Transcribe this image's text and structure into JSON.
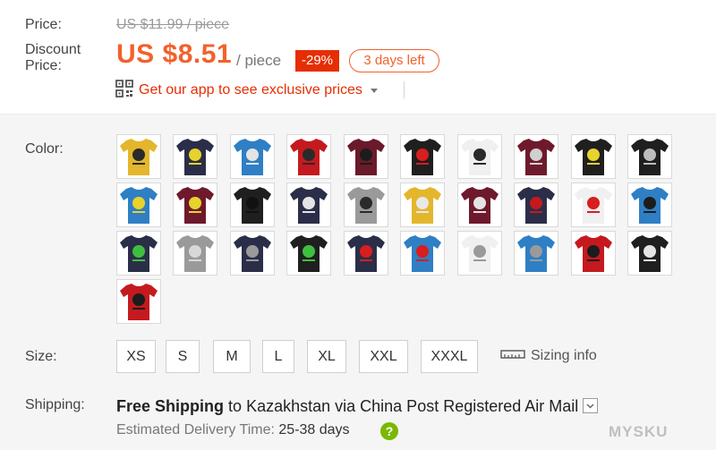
{
  "price": {
    "label": "Price:",
    "original": "US $11.99 / piece",
    "discount_label_line1": "Discount",
    "discount_label_line2": "Price:",
    "sale": "US $8.51",
    "per": "/ piece",
    "badge": "-29%",
    "countdown": "3 days left"
  },
  "app_promo": {
    "text": "Get our app to see exclusive prices",
    "icon": "qr-code-icon"
  },
  "color": {
    "label": "Color:",
    "options": [
      {
        "shirt": "#e3b62c",
        "print": "#2a2a2a"
      },
      {
        "shirt": "#2b2e48",
        "print": "#e8d22d"
      },
      {
        "shirt": "#2f7fc4",
        "print": "#e4e4e4"
      },
      {
        "shirt": "#c41a1f",
        "print": "#2a2a2a"
      },
      {
        "shirt": "#6a1a2a",
        "print": "#1c1c1c"
      },
      {
        "shirt": "#1f1f1f",
        "print": "#d81e1e"
      },
      {
        "shirt": "#f0f0f0",
        "print": "#2a2a2a"
      },
      {
        "shirt": "#6e1a2c",
        "print": "#d0d0d0"
      },
      {
        "shirt": "#1f1f1f",
        "print": "#e8d22d"
      },
      {
        "shirt": "#1f1f1f",
        "print": "#bdbdbd"
      },
      {
        "shirt": "#2f7fc4",
        "print": "#e8d22d"
      },
      {
        "shirt": "#6e1a2c",
        "print": "#e8d22d"
      },
      {
        "shirt": "#1f1f1f",
        "print": "#111111"
      },
      {
        "shirt": "#2b2e48",
        "print": "#e4e4e4"
      },
      {
        "shirt": "#9a9a9a",
        "print": "#2a2a2a"
      },
      {
        "shirt": "#e3b62c",
        "print": "#e8e8e8"
      },
      {
        "shirt": "#6e1a2c",
        "print": "#e4e4e4"
      },
      {
        "shirt": "#2b2e48",
        "print": "#c41a1f"
      },
      {
        "shirt": "#f0f0f0",
        "print": "#d81e1e"
      },
      {
        "shirt": "#2f7fc4",
        "print": "#1c1c1c"
      },
      {
        "shirt": "#2b2e48",
        "print": "#3fbf3f"
      },
      {
        "shirt": "#9a9a9a",
        "print": "#d8d8d8"
      },
      {
        "shirt": "#2b2e48",
        "print": "#9a9a9a"
      },
      {
        "shirt": "#1f1f1f",
        "print": "#3fbf3f"
      },
      {
        "shirt": "#2b2e48",
        "print": "#d81e1e"
      },
      {
        "shirt": "#2f7fc4",
        "print": "#d81e1e"
      },
      {
        "shirt": "#f0f0f0",
        "print": "#9a9a9a"
      },
      {
        "shirt": "#2f7fc4",
        "print": "#9a9a9a"
      },
      {
        "shirt": "#c41a1f",
        "print": "#1c1c1c"
      },
      {
        "shirt": "#1f1f1f",
        "print": "#e4e4e4"
      },
      {
        "shirt": "#c41a1f",
        "print": "#1c1c1c"
      }
    ]
  },
  "size": {
    "label": "Size:",
    "options": [
      "XS",
      "S",
      "M",
      "L",
      "XL",
      "XXL",
      "XXXL"
    ],
    "sizing_info": "Sizing info",
    "sizing_icon": "ruler-icon"
  },
  "shipping": {
    "label": "Shipping:",
    "free": "Free Shipping",
    "to": "to",
    "country": "Kazakhstan",
    "via": "via China Post Registered Air Mail",
    "estimated_label": "Estimated Delivery Time:",
    "days": "25-38 days",
    "help_icon": "question-icon"
  },
  "watermark": "MYSKU"
}
